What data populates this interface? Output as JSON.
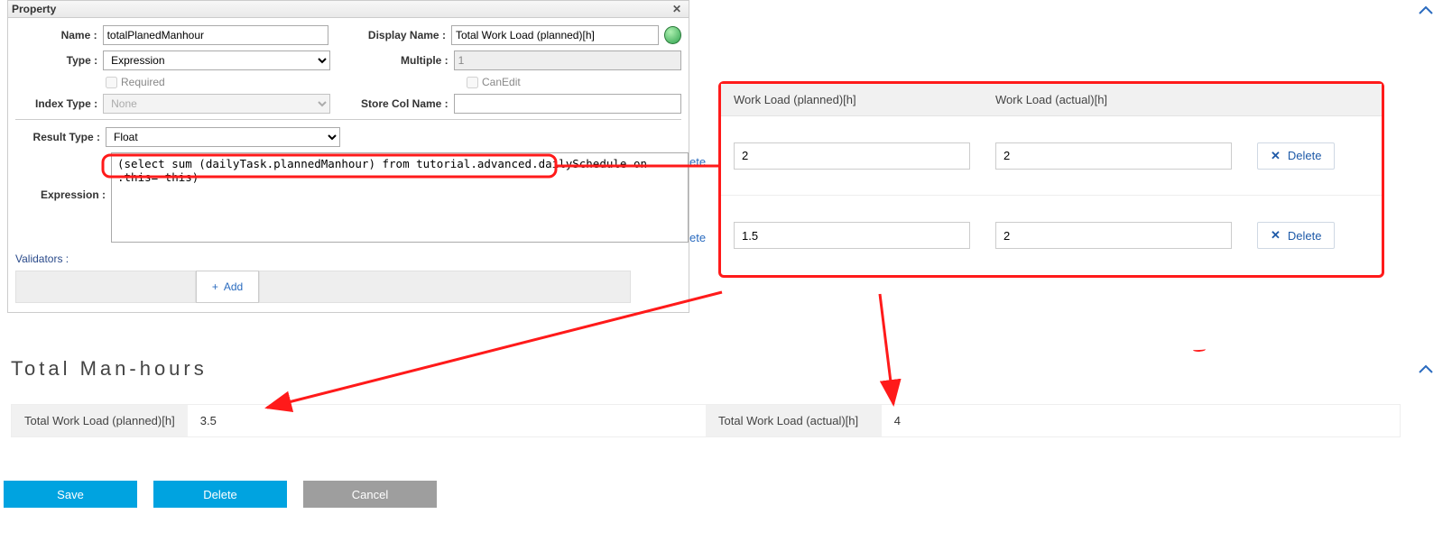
{
  "dialog": {
    "title": "Property",
    "labels": {
      "name": "Name :",
      "display_name": "Display Name :",
      "type": "Type :",
      "multiple": "Multiple :",
      "required": "Required",
      "can_edit": "CanEdit",
      "index_type": "Index Type :",
      "store_col": "Store Col Name :",
      "result_type": "Result Type :",
      "expression": "Expression :",
      "validators": "Validators :"
    },
    "name_value": "totalPlanedManhour",
    "display_name_value": "Total Work Load (planned)[h]",
    "type_value": "Expression",
    "multiple_value": "1",
    "index_type_value": "None",
    "store_col_value": "",
    "result_type_value": "Float",
    "expression_value": "(select sum (dailyTask.plannedManhour) from tutorial.advanced.dailySchedule on .this= this)",
    "add_label": "Add"
  },
  "fragments": {
    "ete": "ete"
  },
  "workload": {
    "headers": {
      "planned": "Work Load (planned)[h]",
      "actual": "Work Load (actual)[h]"
    },
    "rows": [
      {
        "planned": "2",
        "actual": "2",
        "delete": "Delete"
      },
      {
        "planned": "1.5",
        "actual": "2",
        "delete": "Delete"
      }
    ]
  },
  "totals": {
    "heading": "Total Man-hours",
    "planned_label": "Total Work Load (planned)[h]",
    "planned_value": "3.5",
    "actual_label": "Total Work Load (actual)[h]",
    "actual_value": "4"
  },
  "buttons": {
    "save": "Save",
    "delete": "Delete",
    "cancel": "Cancel"
  }
}
